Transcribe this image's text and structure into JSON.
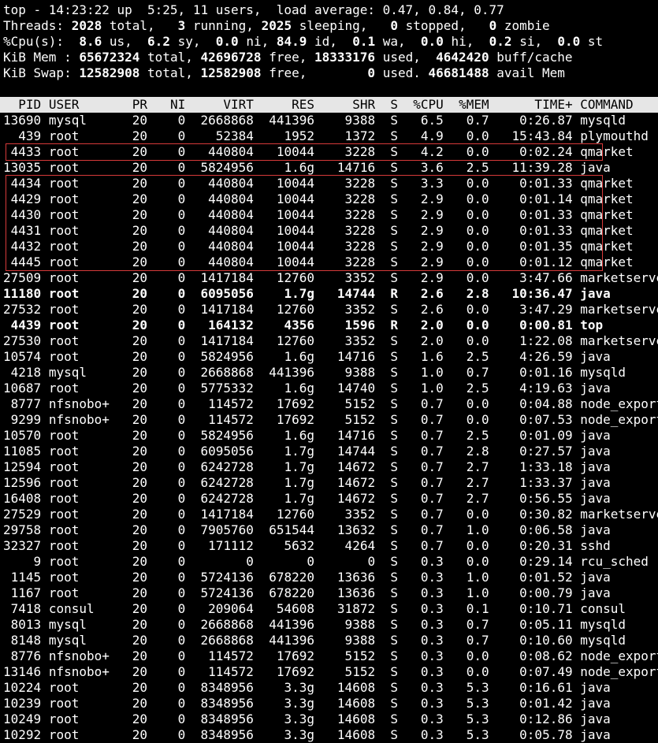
{
  "summary": {
    "l1": "top - 14:23:22 up  5:25, 11 users,  load average: 0.47, 0.84, 0.77",
    "threads": {
      "label": "Threads:",
      "total": "2028",
      "total_l": "total,",
      "running": "3",
      "running_l": "running,",
      "sleeping": "2025",
      "sleeping_l": "sleeping,",
      "stopped": "0",
      "stopped_l": "stopped,",
      "zombie": "0",
      "zombie_l": "zombie"
    },
    "cpu": {
      "label": "%Cpu(s):",
      "us": "8.6",
      "us_l": "us,",
      "sy": "6.2",
      "sy_l": "sy,",
      "ni": "0.0",
      "ni_l": "ni,",
      "id": "84.9",
      "id_l": "id,",
      "wa": "0.1",
      "wa_l": "wa,",
      "hi": "0.0",
      "hi_l": "hi,",
      "si": "0.2",
      "si_l": "si,",
      "st": "0.0",
      "st_l": "st"
    },
    "mem": {
      "label": "KiB Mem :",
      "total": "65672324",
      "total_l": "total,",
      "free": "42696728",
      "free_l": "free,",
      "used": "18333176",
      "used_l": "used,",
      "buff": "4642420",
      "buff_l": "buff/cache"
    },
    "swap": {
      "label": "KiB Swap:",
      "total": "12582908",
      "total_l": "total,",
      "free": "12582908",
      "free_l": "free,",
      "used": "0",
      "used_l": "used.",
      "avail": "46681488",
      "avail_l": "avail Mem"
    }
  },
  "columns": [
    "PID",
    "USER",
    "PR",
    "NI",
    "VIRT",
    "RES",
    "SHR",
    "S",
    "%CPU",
    "%MEM",
    "TIME+",
    "COMMAND"
  ],
  "processes": [
    {
      "pid": "13690",
      "user": "mysql",
      "pr": "20",
      "ni": "0",
      "virt": "2668868",
      "res": "441396",
      "shr": "9388",
      "s": "S",
      "cpu": "6.5",
      "mem": "0.7",
      "time": "0:26.87",
      "cmd": "mysqld"
    },
    {
      "pid": "439",
      "user": "root",
      "pr": "20",
      "ni": "0",
      "virt": "52384",
      "res": "1952",
      "shr": "1372",
      "s": "S",
      "cpu": "4.9",
      "mem": "0.0",
      "time": "15:43.84",
      "cmd": "plymouthd"
    },
    {
      "pid": "4433",
      "user": "root",
      "pr": "20",
      "ni": "0",
      "virt": "440804",
      "res": "10044",
      "shr": "3228",
      "s": "S",
      "cpu": "4.2",
      "mem": "0.0",
      "time": "0:02.24",
      "cmd": "qmarket"
    },
    {
      "pid": "13035",
      "user": "root",
      "pr": "20",
      "ni": "0",
      "virt": "5824956",
      "res": "1.6g",
      "shr": "14716",
      "s": "S",
      "cpu": "3.6",
      "mem": "2.5",
      "time": "11:39.28",
      "cmd": "java"
    },
    {
      "pid": "4434",
      "user": "root",
      "pr": "20",
      "ni": "0",
      "virt": "440804",
      "res": "10044",
      "shr": "3228",
      "s": "S",
      "cpu": "3.3",
      "mem": "0.0",
      "time": "0:01.33",
      "cmd": "qmarket"
    },
    {
      "pid": "4429",
      "user": "root",
      "pr": "20",
      "ni": "0",
      "virt": "440804",
      "res": "10044",
      "shr": "3228",
      "s": "S",
      "cpu": "2.9",
      "mem": "0.0",
      "time": "0:01.14",
      "cmd": "qmarket"
    },
    {
      "pid": "4430",
      "user": "root",
      "pr": "20",
      "ni": "0",
      "virt": "440804",
      "res": "10044",
      "shr": "3228",
      "s": "S",
      "cpu": "2.9",
      "mem": "0.0",
      "time": "0:01.33",
      "cmd": "qmarket"
    },
    {
      "pid": "4431",
      "user": "root",
      "pr": "20",
      "ni": "0",
      "virt": "440804",
      "res": "10044",
      "shr": "3228",
      "s": "S",
      "cpu": "2.9",
      "mem": "0.0",
      "time": "0:01.33",
      "cmd": "qmarket"
    },
    {
      "pid": "4432",
      "user": "root",
      "pr": "20",
      "ni": "0",
      "virt": "440804",
      "res": "10044",
      "shr": "3228",
      "s": "S",
      "cpu": "2.9",
      "mem": "0.0",
      "time": "0:01.35",
      "cmd": "qmarket"
    },
    {
      "pid": "4445",
      "user": "root",
      "pr": "20",
      "ni": "0",
      "virt": "440804",
      "res": "10044",
      "shr": "3228",
      "s": "S",
      "cpu": "2.9",
      "mem": "0.0",
      "time": "0:01.12",
      "cmd": "qmarket"
    },
    {
      "pid": "27509",
      "user": "root",
      "pr": "20",
      "ni": "0",
      "virt": "1417184",
      "res": "12760",
      "shr": "3352",
      "s": "S",
      "cpu": "2.9",
      "mem": "0.0",
      "time": "3:47.66",
      "cmd": "marketserver"
    },
    {
      "pid": "11180",
      "user": "root",
      "pr": "20",
      "ni": "0",
      "virt": "6095056",
      "res": "1.7g",
      "shr": "14744",
      "s": "R",
      "cpu": "2.6",
      "mem": "2.8",
      "time": "10:36.47",
      "cmd": "java",
      "bold": true
    },
    {
      "pid": "27532",
      "user": "root",
      "pr": "20",
      "ni": "0",
      "virt": "1417184",
      "res": "12760",
      "shr": "3352",
      "s": "S",
      "cpu": "2.6",
      "mem": "0.0",
      "time": "3:47.29",
      "cmd": "marketserver"
    },
    {
      "pid": "4439",
      "user": "root",
      "pr": "20",
      "ni": "0",
      "virt": "164132",
      "res": "4356",
      "shr": "1596",
      "s": "R",
      "cpu": "2.0",
      "mem": "0.0",
      "time": "0:00.81",
      "cmd": "top",
      "bold": true
    },
    {
      "pid": "27530",
      "user": "root",
      "pr": "20",
      "ni": "0",
      "virt": "1417184",
      "res": "12760",
      "shr": "3352",
      "s": "S",
      "cpu": "2.0",
      "mem": "0.0",
      "time": "1:22.08",
      "cmd": "marketserver"
    },
    {
      "pid": "10574",
      "user": "root",
      "pr": "20",
      "ni": "0",
      "virt": "5824956",
      "res": "1.6g",
      "shr": "14716",
      "s": "S",
      "cpu": "1.6",
      "mem": "2.5",
      "time": "4:26.59",
      "cmd": "java"
    },
    {
      "pid": "4218",
      "user": "mysql",
      "pr": "20",
      "ni": "0",
      "virt": "2668868",
      "res": "441396",
      "shr": "9388",
      "s": "S",
      "cpu": "1.0",
      "mem": "0.7",
      "time": "0:01.16",
      "cmd": "mysqld"
    },
    {
      "pid": "10687",
      "user": "root",
      "pr": "20",
      "ni": "0",
      "virt": "5775332",
      "res": "1.6g",
      "shr": "14740",
      "s": "S",
      "cpu": "1.0",
      "mem": "2.5",
      "time": "4:19.63",
      "cmd": "java"
    },
    {
      "pid": "8777",
      "user": "nfsnobo+",
      "pr": "20",
      "ni": "0",
      "virt": "114572",
      "res": "17692",
      "shr": "5152",
      "s": "S",
      "cpu": "0.7",
      "mem": "0.0",
      "time": "0:04.88",
      "cmd": "node_exporter"
    },
    {
      "pid": "9299",
      "user": "nfsnobo+",
      "pr": "20",
      "ni": "0",
      "virt": "114572",
      "res": "17692",
      "shr": "5152",
      "s": "S",
      "cpu": "0.7",
      "mem": "0.0",
      "time": "0:07.53",
      "cmd": "node_exporter"
    },
    {
      "pid": "10570",
      "user": "root",
      "pr": "20",
      "ni": "0",
      "virt": "5824956",
      "res": "1.6g",
      "shr": "14716",
      "s": "S",
      "cpu": "0.7",
      "mem": "2.5",
      "time": "0:01.09",
      "cmd": "java"
    },
    {
      "pid": "11085",
      "user": "root",
      "pr": "20",
      "ni": "0",
      "virt": "6095056",
      "res": "1.7g",
      "shr": "14744",
      "s": "S",
      "cpu": "0.7",
      "mem": "2.8",
      "time": "0:27.57",
      "cmd": "java"
    },
    {
      "pid": "12594",
      "user": "root",
      "pr": "20",
      "ni": "0",
      "virt": "6242728",
      "res": "1.7g",
      "shr": "14672",
      "s": "S",
      "cpu": "0.7",
      "mem": "2.7",
      "time": "1:33.18",
      "cmd": "java"
    },
    {
      "pid": "12596",
      "user": "root",
      "pr": "20",
      "ni": "0",
      "virt": "6242728",
      "res": "1.7g",
      "shr": "14672",
      "s": "S",
      "cpu": "0.7",
      "mem": "2.7",
      "time": "1:33.37",
      "cmd": "java"
    },
    {
      "pid": "16408",
      "user": "root",
      "pr": "20",
      "ni": "0",
      "virt": "6242728",
      "res": "1.7g",
      "shr": "14672",
      "s": "S",
      "cpu": "0.7",
      "mem": "2.7",
      "time": "0:56.55",
      "cmd": "java"
    },
    {
      "pid": "27529",
      "user": "root",
      "pr": "20",
      "ni": "0",
      "virt": "1417184",
      "res": "12760",
      "shr": "3352",
      "s": "S",
      "cpu": "0.7",
      "mem": "0.0",
      "time": "0:30.82",
      "cmd": "marketserver"
    },
    {
      "pid": "29758",
      "user": "root",
      "pr": "20",
      "ni": "0",
      "virt": "7905760",
      "res": "651544",
      "shr": "13632",
      "s": "S",
      "cpu": "0.7",
      "mem": "1.0",
      "time": "0:06.58",
      "cmd": "java"
    },
    {
      "pid": "32327",
      "user": "root",
      "pr": "20",
      "ni": "0",
      "virt": "171112",
      "res": "5632",
      "shr": "4264",
      "s": "S",
      "cpu": "0.7",
      "mem": "0.0",
      "time": "0:20.31",
      "cmd": "sshd"
    },
    {
      "pid": "9",
      "user": "root",
      "pr": "20",
      "ni": "0",
      "virt": "0",
      "res": "0",
      "shr": "0",
      "s": "S",
      "cpu": "0.3",
      "mem": "0.0",
      "time": "0:29.14",
      "cmd": "rcu_sched"
    },
    {
      "pid": "1145",
      "user": "root",
      "pr": "20",
      "ni": "0",
      "virt": "5724136",
      "res": "678220",
      "shr": "13636",
      "s": "S",
      "cpu": "0.3",
      "mem": "1.0",
      "time": "0:01.52",
      "cmd": "java"
    },
    {
      "pid": "1167",
      "user": "root",
      "pr": "20",
      "ni": "0",
      "virt": "5724136",
      "res": "678220",
      "shr": "13636",
      "s": "S",
      "cpu": "0.3",
      "mem": "1.0",
      "time": "0:00.79",
      "cmd": "java"
    },
    {
      "pid": "7418",
      "user": "consul",
      "pr": "20",
      "ni": "0",
      "virt": "209064",
      "res": "54608",
      "shr": "31872",
      "s": "S",
      "cpu": "0.3",
      "mem": "0.1",
      "time": "0:10.71",
      "cmd": "consul"
    },
    {
      "pid": "8013",
      "user": "mysql",
      "pr": "20",
      "ni": "0",
      "virt": "2668868",
      "res": "441396",
      "shr": "9388",
      "s": "S",
      "cpu": "0.3",
      "mem": "0.7",
      "time": "0:05.11",
      "cmd": "mysqld"
    },
    {
      "pid": "8148",
      "user": "mysql",
      "pr": "20",
      "ni": "0",
      "virt": "2668868",
      "res": "441396",
      "shr": "9388",
      "s": "S",
      "cpu": "0.3",
      "mem": "0.7",
      "time": "0:10.60",
      "cmd": "mysqld"
    },
    {
      "pid": "8776",
      "user": "nfsnobo+",
      "pr": "20",
      "ni": "0",
      "virt": "114572",
      "res": "17692",
      "shr": "5152",
      "s": "S",
      "cpu": "0.3",
      "mem": "0.0",
      "time": "0:08.62",
      "cmd": "node_exporter"
    },
    {
      "pid": "13146",
      "user": "nfsnobo+",
      "pr": "20",
      "ni": "0",
      "virt": "114572",
      "res": "17692",
      "shr": "5152",
      "s": "S",
      "cpu": "0.3",
      "mem": "0.0",
      "time": "0:07.49",
      "cmd": "node_exporter"
    },
    {
      "pid": "10224",
      "user": "root",
      "pr": "20",
      "ni": "0",
      "virt": "8348956",
      "res": "3.3g",
      "shr": "14608",
      "s": "S",
      "cpu": "0.3",
      "mem": "5.3",
      "time": "0:16.61",
      "cmd": "java"
    },
    {
      "pid": "10239",
      "user": "root",
      "pr": "20",
      "ni": "0",
      "virt": "8348956",
      "res": "3.3g",
      "shr": "14608",
      "s": "S",
      "cpu": "0.3",
      "mem": "5.3",
      "time": "0:01.42",
      "cmd": "java"
    },
    {
      "pid": "10249",
      "user": "root",
      "pr": "20",
      "ni": "0",
      "virt": "8348956",
      "res": "3.3g",
      "shr": "14608",
      "s": "S",
      "cpu": "0.3",
      "mem": "5.3",
      "time": "0:12.86",
      "cmd": "java"
    },
    {
      "pid": "10292",
      "user": "root",
      "pr": "20",
      "ni": "0",
      "virt": "8348956",
      "res": "3.3g",
      "shr": "14608",
      "s": "S",
      "cpu": "0.3",
      "mem": "5.3",
      "time": "0:05.78",
      "cmd": "java"
    }
  ],
  "colors": {
    "background": "#000000",
    "text": "#ffffff",
    "header_bg": "#e6e6e6",
    "highlight_border": "#d63a3a"
  }
}
